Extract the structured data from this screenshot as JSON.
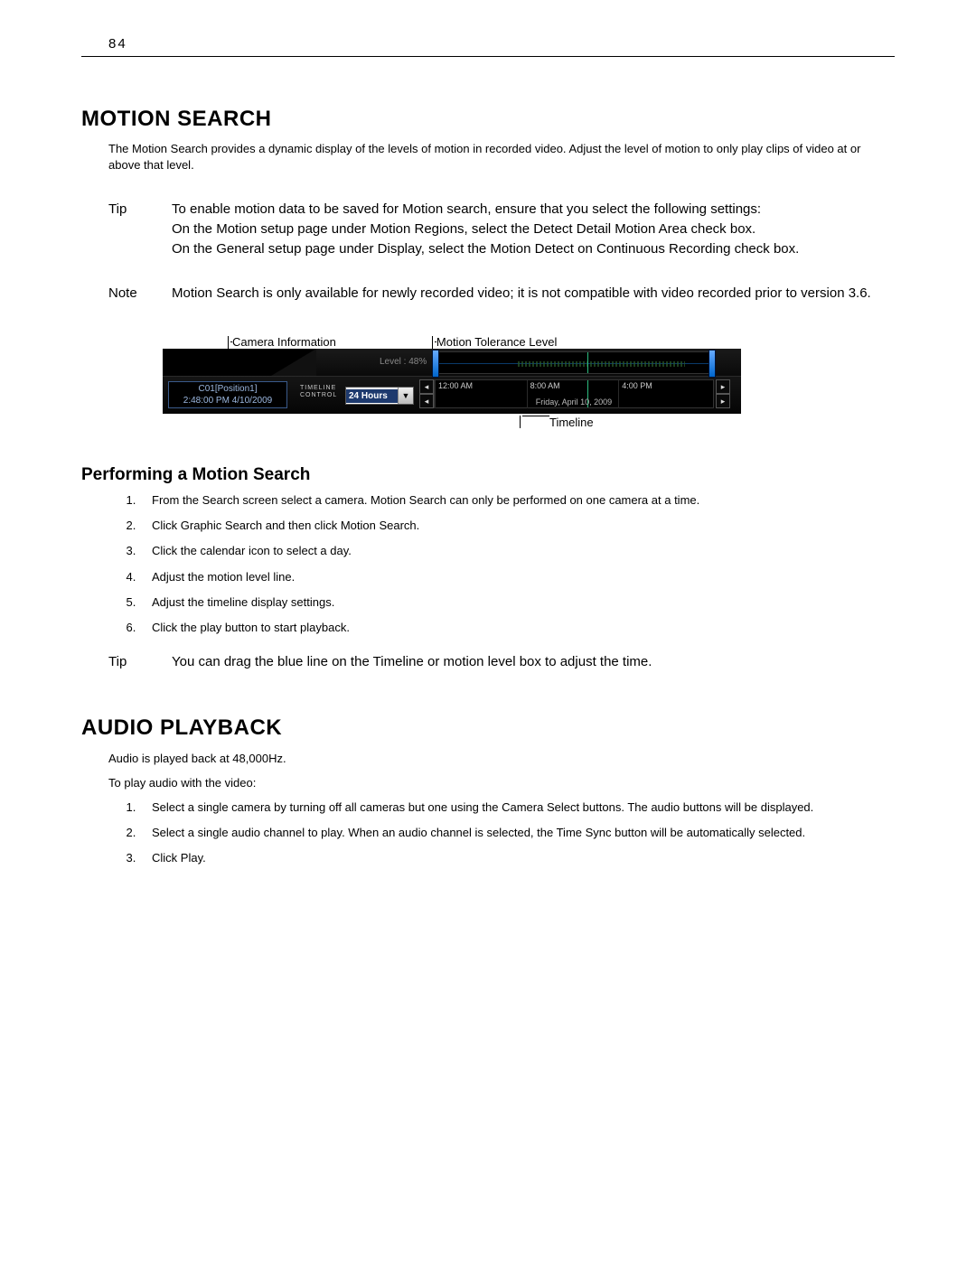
{
  "page_number": "84",
  "section1": {
    "title": "MOTION SEARCH",
    "intro": "The Motion Search provides a dynamic display of the levels of motion in recorded video.  Adjust the level of motion to only play clips of video at or above that level.",
    "tip_label": "Tip",
    "tip_text": "To enable motion data to be saved for Motion search, ensure that you select the following settings:\nOn the Motion setup page under Motion Regions, select the Detect Detail Motion Area check box.\nOn the General setup page under Display, select the Motion Detect on Continuous Recording check box.",
    "note_label": "Note",
    "note_text": "Motion Search is only available for newly recorded video; it is not compatible with video recorded prior to version 3.6."
  },
  "figure": {
    "callout_camera": "Camera Information",
    "callout_motion": "Motion Tolerance Level",
    "callout_timeline": "Timeline",
    "camera_line1": "C01[Position1]",
    "camera_line2": "2:48:00 PM  4/10/2009",
    "tl_ctrl_label": "TIMELINE\nCONTROL",
    "tl_dropdown_value": "24 Hours",
    "level_label": "Level :  48%",
    "timeline_ticks": [
      "12:00 AM",
      "8:00 AM",
      "4:00 PM"
    ],
    "timeline_date": "Friday, April 10, 2009"
  },
  "subsection": {
    "title": "Performing a Motion Search",
    "steps": [
      "From the Search screen select a camera.  Motion Search can only be performed on one camera at a time.",
      "Click Graphic Search and then click Motion Search.",
      "Click the calendar icon to select a day.",
      "Adjust the motion level line.",
      "Adjust the timeline display settings.",
      "Click the play button to start playback."
    ],
    "tip_label": "Tip",
    "tip_text": "You can drag the blue line on the Timeline or motion level box to adjust the time."
  },
  "section2": {
    "title": "AUDIO PLAYBACK",
    "line1": "Audio is played back at 48,000Hz.",
    "line2": "To play audio with the video:",
    "steps": [
      "Select a single camera by turning off all cameras but one using the Camera Select buttons.  The audio buttons will be displayed.",
      "Select a single audio channel to play.  When an audio channel is selected, the Time Sync button will be automatically selected.",
      "Click Play."
    ]
  }
}
